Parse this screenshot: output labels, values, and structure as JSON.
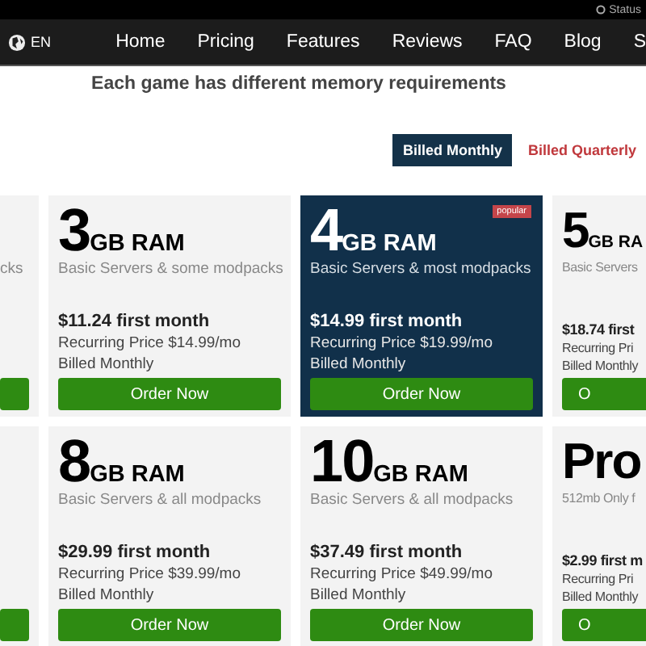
{
  "top_bar": {
    "status_link": "Status"
  },
  "nav": {
    "language": "EN",
    "items": [
      "Home",
      "Pricing",
      "Features",
      "Reviews",
      "FAQ",
      "Blog",
      "S"
    ]
  },
  "headline": "Each game has different memory requirements",
  "billing_toggle": [
    {
      "label": "Billed Monthly",
      "selected": true
    },
    {
      "label": "Billed Quarterly",
      "selected": false
    }
  ],
  "plan_rows": [
    [
      {
        "kind": "edge-left",
        "description": "cks"
      },
      {
        "kind": "full",
        "size": "3",
        "unit": "GB RAM",
        "description": "Basic Servers & some modpacks",
        "first_month": "$11.24 first month",
        "recurring": "Recurring Price $14.99/mo",
        "billing": "Billed Monthly",
        "button": "Order Now",
        "highlighted": false
      },
      {
        "kind": "full",
        "size": "4",
        "unit": "GB RAM",
        "description": "Basic Servers & most modpacks",
        "first_month": "$14.99 first month",
        "recurring": "Recurring Price $19.99/mo",
        "billing": "Billed Monthly",
        "button": "Order Now",
        "highlighted": true,
        "badge": "popular"
      },
      {
        "kind": "edge-right",
        "size": "5",
        "unit": "GB RA",
        "description": "Basic Servers",
        "first_month": "$18.74 first",
        "recurring": "Recurring Pri",
        "billing": "Billed Monthly",
        "button": "O",
        "highlighted": false
      }
    ],
    [
      {
        "kind": "edge-left"
      },
      {
        "kind": "full",
        "size": "8",
        "unit": "GB RAM",
        "description": "Basic Servers & all modpacks",
        "first_month": "$29.99 first month",
        "recurring": "Recurring Price $39.99/mo",
        "billing": "Billed Monthly",
        "button": "Order Now",
        "highlighted": false
      },
      {
        "kind": "full",
        "size": "10",
        "unit": "GB RAM",
        "description": "Basic Servers & all modpacks",
        "first_month": "$37.49 first month",
        "recurring": "Recurring Price $49.99/mo",
        "billing": "Billed Monthly",
        "button": "Order Now",
        "highlighted": false
      },
      {
        "kind": "edge-right",
        "size": "Pro",
        "description": "512mb Only f",
        "first_month": "$2.99 first m",
        "recurring": "Recurring Pri",
        "billing": "Billed Monthly",
        "button": "O",
        "highlighted": false
      }
    ]
  ]
}
